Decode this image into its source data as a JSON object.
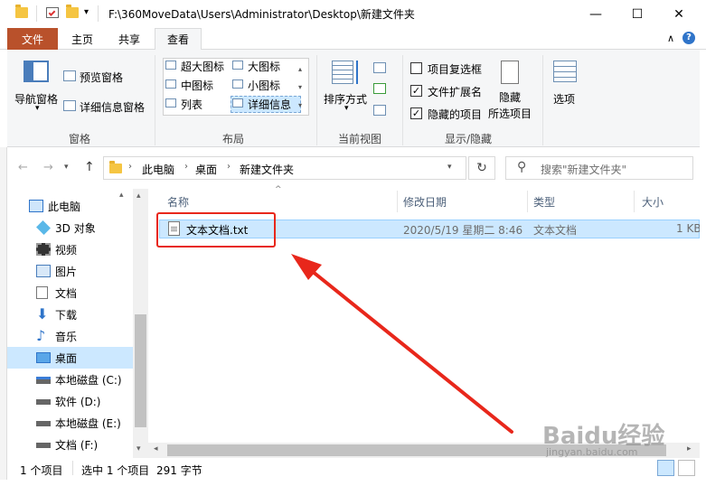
{
  "window": {
    "title": "F:\\360MoveData\\Users\\Administrator\\Desktop\\新建文件夹",
    "minimize": "—",
    "maximize": "☐",
    "close": "✕"
  },
  "ribbon_tabs": [
    "文件",
    "主页",
    "共享",
    "查看"
  ],
  "ribbon": {
    "panes": {
      "nav_pane": "导航窗格",
      "preview_pane": "预览窗格",
      "details_pane": "详细信息窗格",
      "group": "窗格"
    },
    "layout": {
      "items": [
        "超大图标",
        "大图标",
        "中图标",
        "小图标",
        "列表",
        "详细信息"
      ],
      "group": "布局"
    },
    "current_view": {
      "sort_by": "排序方式",
      "group": "当前视图"
    },
    "show_hide": {
      "item_checkboxes": "项目复选框",
      "file_extensions": "文件扩展名",
      "hidden_items": "隐藏的项目",
      "hide_selected_line1": "隐藏",
      "hide_selected_line2": "所选项目",
      "group": "显示/隐藏",
      "item_checkboxes_checked": false,
      "file_extensions_checked": true,
      "hidden_items_checked": true
    },
    "options": "选项"
  },
  "address": {
    "crumbs": [
      "此电脑",
      "桌面",
      "新建文件夹"
    ],
    "search_placeholder": "搜索\"新建文件夹\""
  },
  "nav_items": [
    {
      "label": "此电脑",
      "icon": "computer-icon"
    },
    {
      "label": "3D 对象",
      "icon": "3d-objects-icon"
    },
    {
      "label": "视频",
      "icon": "video-icon"
    },
    {
      "label": "图片",
      "icon": "pictures-icon"
    },
    {
      "label": "文档",
      "icon": "documents-icon"
    },
    {
      "label": "下载",
      "icon": "download-icon"
    },
    {
      "label": "音乐",
      "icon": "music-icon"
    },
    {
      "label": "桌面",
      "icon": "desktop-icon"
    },
    {
      "label": "本地磁盘 (C:)",
      "icon": "drive-icon"
    },
    {
      "label": "软件 (D:)",
      "icon": "drive-icon"
    },
    {
      "label": "本地磁盘 (E:)",
      "icon": "drive-icon"
    },
    {
      "label": "文档 (F:)",
      "icon": "drive-icon"
    }
  ],
  "columns": [
    "名称",
    "修改日期",
    "类型",
    "大小"
  ],
  "files": [
    {
      "name": "文本文档.txt",
      "modified": "2020/5/19 星期二 8:46",
      "type": "文本文档",
      "size": "1 KB"
    }
  ],
  "status": {
    "count": "1 个项目",
    "selected": "选中 1 个项目",
    "size": "291 字节"
  },
  "watermark": "Baidu经验",
  "watermark_sub": "jingyan.baidu.com",
  "colors": {
    "accent_file_tab": "#b9512b",
    "selection": "#cce8ff",
    "annotation": "#e8271b"
  }
}
